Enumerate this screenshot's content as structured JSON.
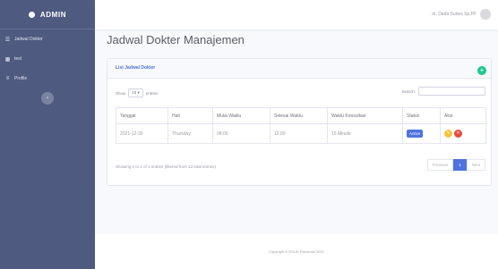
{
  "sidebar": {
    "brand": "ADMIN",
    "items": [
      {
        "icon": "users-icon",
        "glyph": "☰",
        "label": "Jadwal Dokter"
      },
      {
        "icon": "grid-icon",
        "glyph": "▦",
        "label": "test"
      },
      {
        "icon": "list-icon",
        "glyph": "≡",
        "label": "Profile"
      }
    ],
    "toggle_glyph": "‹"
  },
  "topbar": {
    "user_name": "dr. Dada Suries Sp.PF"
  },
  "page": {
    "title": "Jadwal Dokter Manajemen"
  },
  "card": {
    "title": "List Jadwal Dokter",
    "add_glyph": "+",
    "show_label": "Show",
    "entries_value": "10",
    "entries_label": "entries",
    "search_label": "Search:",
    "search_placeholder": "",
    "columns": [
      "Tanggal",
      "Hari",
      "Mulai Waktu",
      "Selesai Waktu",
      "Waktu Konsultasi",
      "Status",
      "Aksi"
    ],
    "rows": [
      {
        "tanggal": "2021-12-30",
        "hari": "Thursday",
        "mulai": "08:00",
        "selesai": "12:00",
        "konsultasi": "15 Minute",
        "status": "Active"
      }
    ],
    "info": "Showing 1 to 1 of 1 entries (filtered from 13 total entries)",
    "pager": {
      "prev": "Previous",
      "current": "1",
      "next": "Next"
    }
  },
  "footer": {
    "copyright": "Copyright © RSUD Pasuruan 2021"
  },
  "colors": {
    "sidebar": "#4e5a80",
    "primary": "#4e73df",
    "success": "#1cc88a",
    "warning": "#f6c23e",
    "danger": "#e74a3b"
  }
}
